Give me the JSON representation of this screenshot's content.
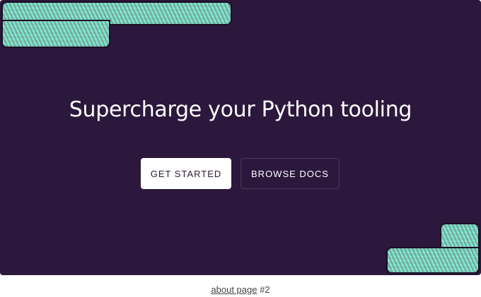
{
  "hero": {
    "title": "Supercharge your Python tooling",
    "primary_button": "GET STARTED",
    "secondary_button": "BROWSE DOCS",
    "background_color": "#2c183c",
    "accent_color": "#7ee8d6"
  },
  "footer": {
    "link_text": "about page",
    "suffix": "#2"
  }
}
